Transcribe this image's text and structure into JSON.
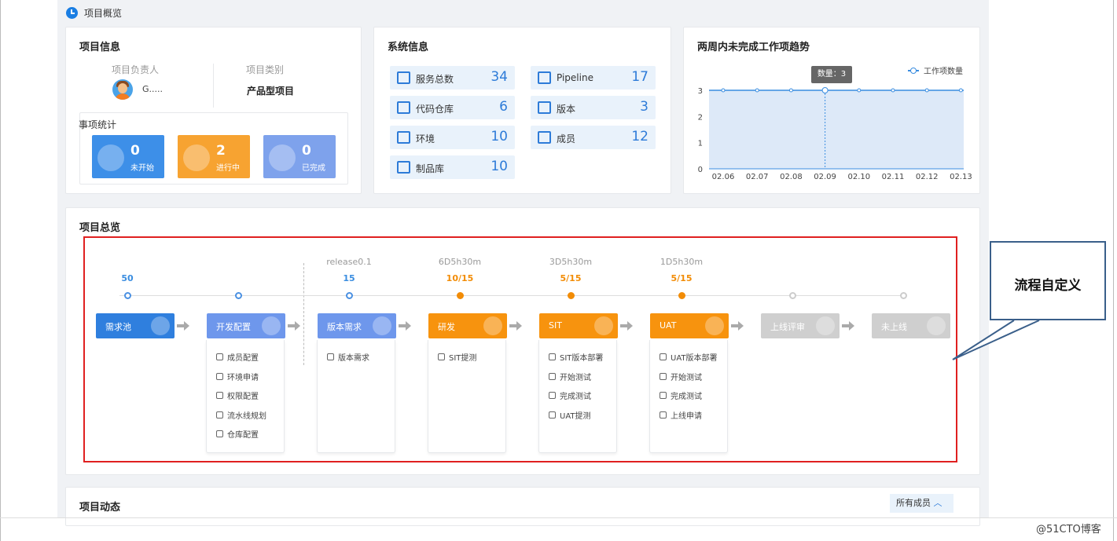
{
  "header": {
    "title": "项目概览"
  },
  "project_info": {
    "title": "项目信息",
    "owner_label": "项目负责人",
    "owner_name": "G.....",
    "type_label": "项目类别",
    "type_value": "产品型项目",
    "stats_title": "事项统计",
    "stats": [
      {
        "value": "0",
        "label": "未开始",
        "color": "#3d8fe8"
      },
      {
        "value": "2",
        "label": "进行中",
        "color": "#f7a331"
      },
      {
        "value": "0",
        "label": "已完成",
        "color": "#7ea2ec"
      }
    ]
  },
  "system_info": {
    "title": "系统信息",
    "items": [
      {
        "label": "服务总数",
        "value": "34",
        "icon": "home-icon"
      },
      {
        "label": "Pipeline",
        "value": "17",
        "icon": "pipeline-icon"
      },
      {
        "label": "代码仓库",
        "value": "6",
        "icon": "monitor-icon"
      },
      {
        "label": "版本",
        "value": "3",
        "icon": "version-icon"
      },
      {
        "label": "环境",
        "value": "10",
        "icon": "grid-icon"
      },
      {
        "label": "成员",
        "value": "12",
        "icon": "users-icon"
      },
      {
        "label": "制品库",
        "value": "10",
        "icon": "box-icon"
      }
    ]
  },
  "trend": {
    "title": "两周内未完成工作项趋势",
    "legend": "工作项数量",
    "tooltip": "数量：3"
  },
  "chart_data": {
    "type": "area",
    "title": "两周内未完成工作项趋势",
    "x": [
      "02.06",
      "02.07",
      "02.08",
      "02.09",
      "02.10",
      "02.11",
      "02.12",
      "02.13"
    ],
    "series": [
      {
        "name": "工作项数量",
        "values": [
          3,
          3,
          3,
          3,
          3,
          3,
          3,
          3
        ]
      }
    ],
    "ylim": [
      0,
      3
    ],
    "yticks": [
      "0",
      "1",
      "2",
      "3"
    ],
    "legend_position": "top-right",
    "grid": true
  },
  "overview": {
    "title": "项目总览",
    "stages": [
      {
        "name": "需求池",
        "count": "50",
        "color": "#2f7fde",
        "top": "",
        "kind": "blue",
        "items": []
      },
      {
        "name": "开发配置",
        "count": "",
        "color": "#6e97ec",
        "top": "",
        "kind": "blue",
        "items": [
          "成员配置",
          "环境申请",
          "权限配置",
          "流水线规划",
          "仓库配置"
        ]
      },
      {
        "name": "版本需求",
        "count": "15",
        "color": "#6e97ec",
        "top": "release0.1",
        "kind": "blue",
        "items": [
          "版本需求"
        ]
      },
      {
        "name": "研发",
        "count": "10/15",
        "color": "#f7930e",
        "top": "6D5h30m",
        "kind": "orange",
        "items": [
          "SIT提测"
        ]
      },
      {
        "name": "SIT",
        "count": "5/15",
        "color": "#f7930e",
        "top": "3D5h30m",
        "kind": "orange",
        "items": [
          "SIT版本部署",
          "开始测试",
          "完成测试",
          "UAT提测"
        ]
      },
      {
        "name": "UAT",
        "count": "5/15",
        "color": "#f7930e",
        "top": "1D5h30m",
        "kind": "orange",
        "items": [
          "UAT版本部署",
          "开始测试",
          "完成测试",
          "上线申请"
        ]
      },
      {
        "name": "上线评审",
        "count": "",
        "color": "#cfcfcf",
        "top": "",
        "kind": "gray",
        "items": []
      },
      {
        "name": "未上线",
        "count": "",
        "color": "#cfcfcf",
        "top": "",
        "kind": "gray",
        "items": []
      }
    ]
  },
  "callout": {
    "text": "流程自定义"
  },
  "activity": {
    "title": "项目动态",
    "filter": "所有成员"
  },
  "watermark": "@51CTO博客"
}
